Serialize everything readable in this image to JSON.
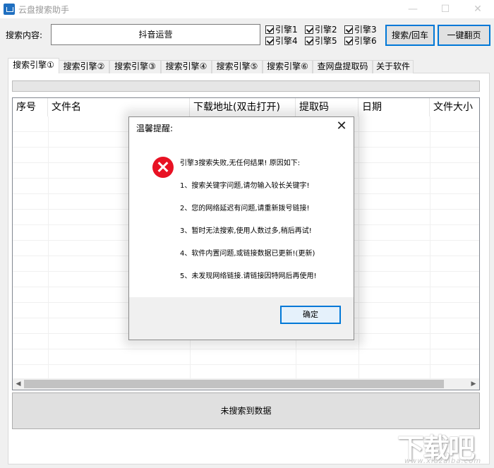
{
  "window": {
    "title": "云盘搜索助手",
    "minimize": "—",
    "maximize": "☐",
    "close": "✕"
  },
  "search": {
    "label": "搜索内容:",
    "value": "抖音运营"
  },
  "engines": [
    {
      "label": "引擎1",
      "checked": true
    },
    {
      "label": "引擎2",
      "checked": true
    },
    {
      "label": "引擎3",
      "checked": true
    },
    {
      "label": "引擎4",
      "checked": true
    },
    {
      "label": "引擎5",
      "checked": true
    },
    {
      "label": "引擎6",
      "checked": true
    }
  ],
  "buttons": {
    "search": "搜索/回车",
    "flip": "一键翻页"
  },
  "tabs": [
    "搜索引擎①",
    "搜索引擎②",
    "搜索引擎③",
    "搜索引擎④",
    "搜索引擎⑤",
    "搜索引擎⑥",
    "查网盘提取码",
    "关于软件"
  ],
  "columns": [
    "序号",
    "文件名",
    "下载地址(双击打开)",
    "提取码",
    "日期",
    "文件大小"
  ],
  "status": "未搜索到数据",
  "dialog": {
    "title": "温馨提醒:",
    "close": "✕",
    "messages": [
      "引擎3搜索失败,无任何结果!  原因如下:",
      "1、搜索关键字问题,请勿输入较长关键字!",
      "2、您的网络延迟有问题,请重新拨号链接!",
      "3、暂时无法搜索,使用人数过多,稍后再试!",
      "4、软件内置问题,或链接数据已更新!(更新)",
      "5、未发现网络链接.请链接因特网后再使用!"
    ],
    "ok": "确定"
  },
  "watermark": {
    "text": "下载吧",
    "url": "www.xiazaiba.com"
  },
  "colors": {
    "accent": "#0078d7",
    "error": "#e81123"
  }
}
